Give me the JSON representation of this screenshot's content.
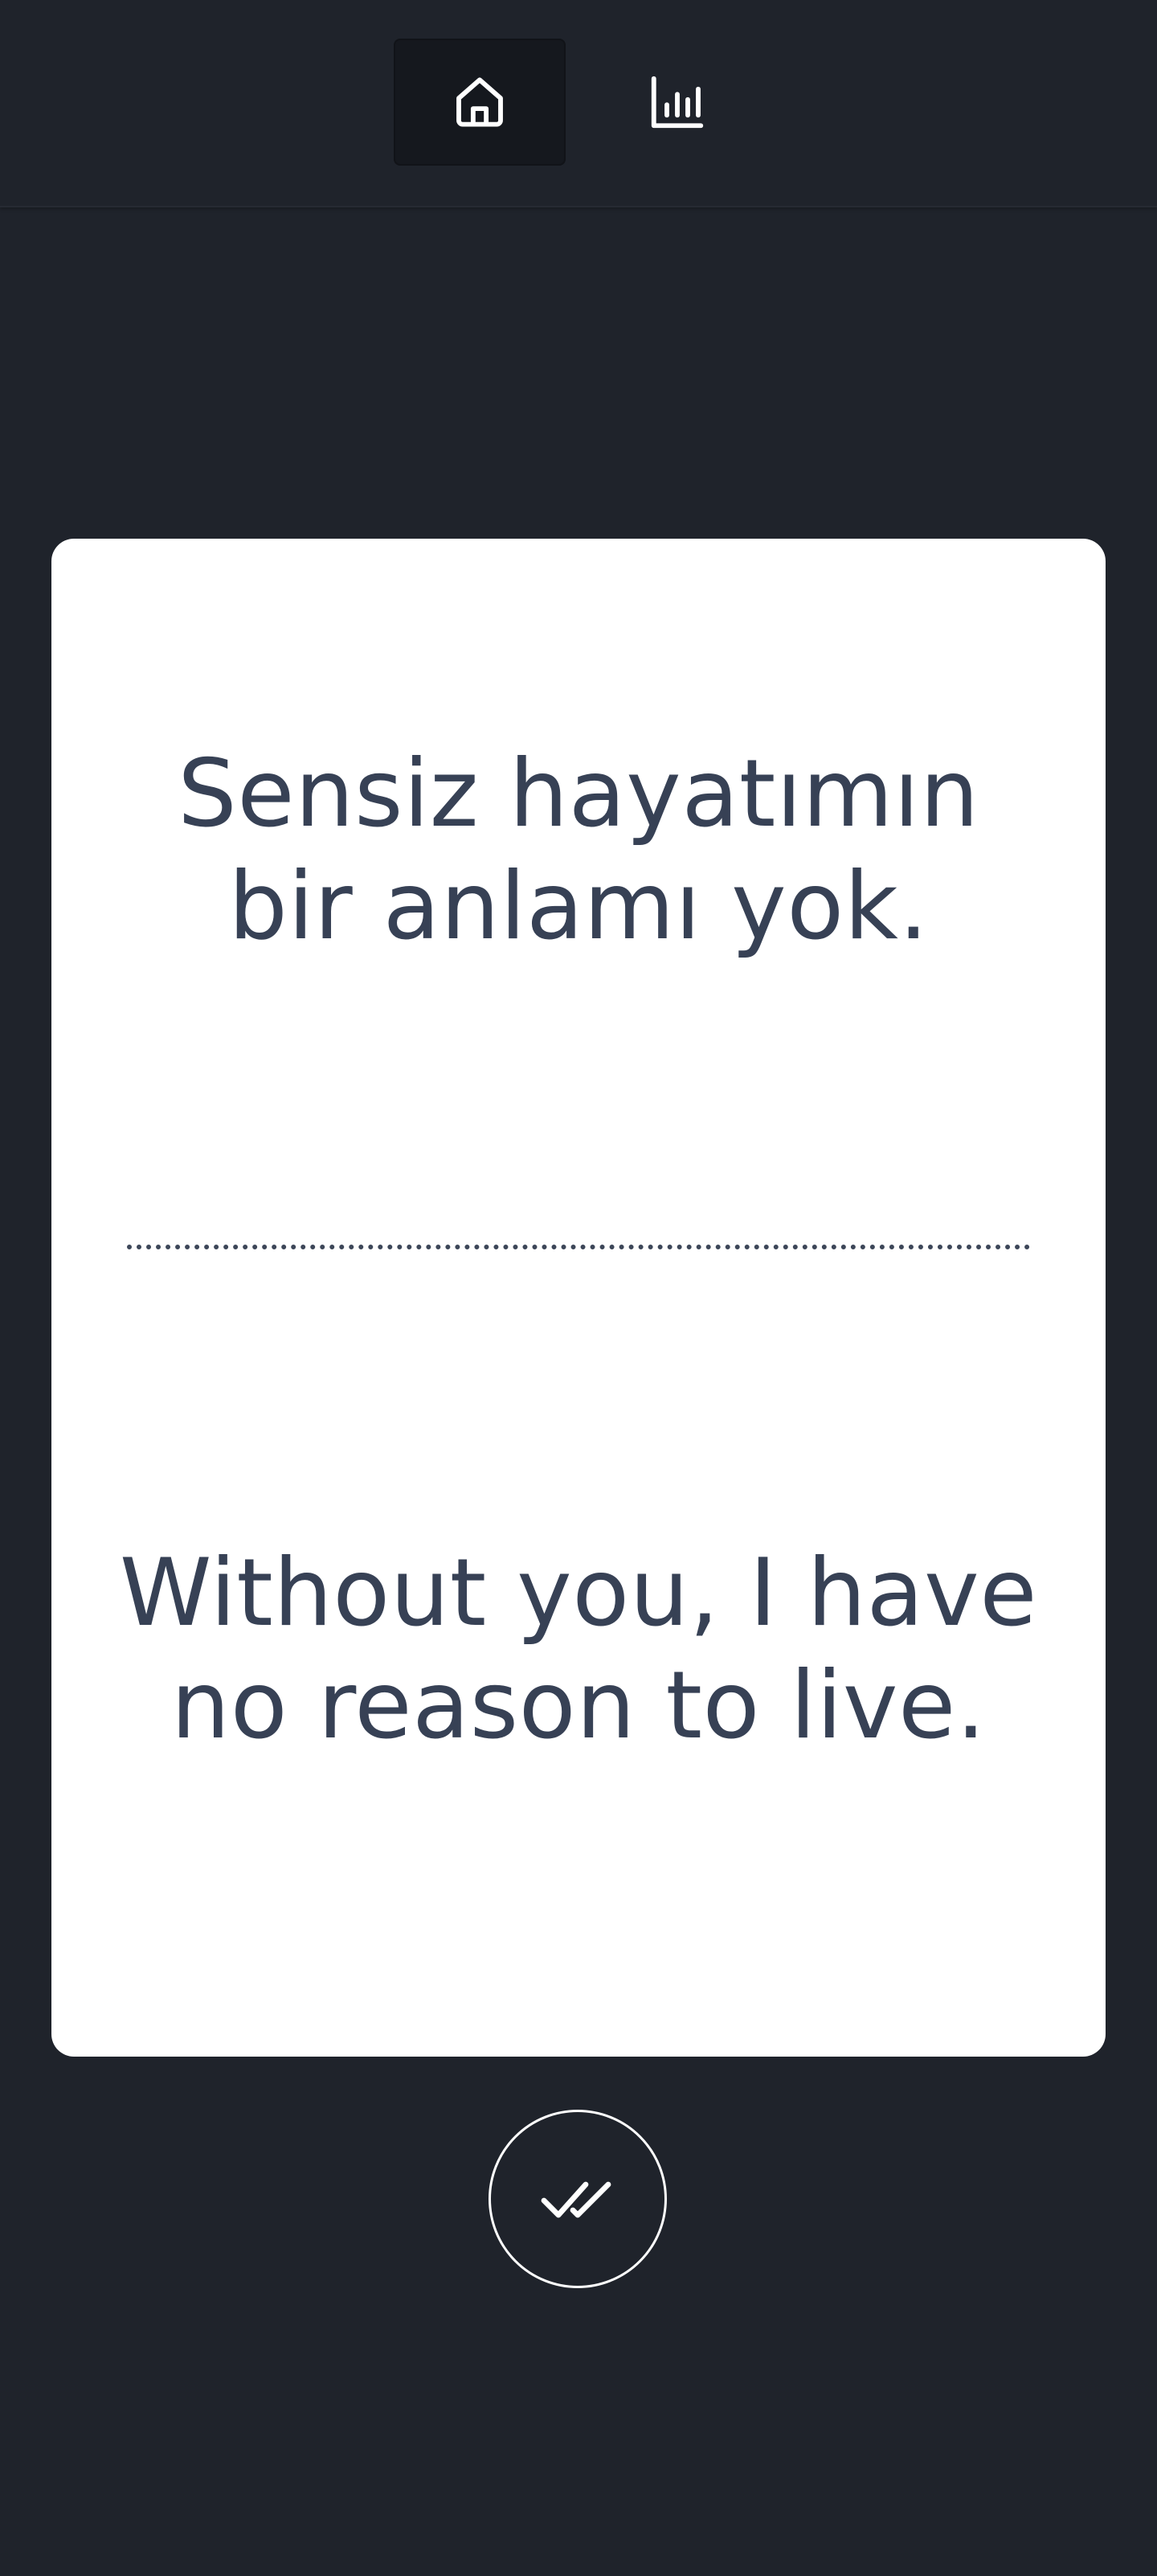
{
  "nav": {
    "items": [
      {
        "id": "home",
        "icon": "home-icon",
        "active": true
      },
      {
        "id": "stats",
        "icon": "bar-chart-icon",
        "active": false
      }
    ]
  },
  "card": {
    "source_phrase": "Sensiz hayatımın bir anlamı yok.",
    "target_phrase": "Without you, I have no reason to live."
  },
  "actions": {
    "mark_done_icon": "double-check-icon"
  },
  "colors": {
    "background": "#1f232b",
    "card": "#ffffff",
    "text": "#374155",
    "active_nav": "#15181e"
  }
}
